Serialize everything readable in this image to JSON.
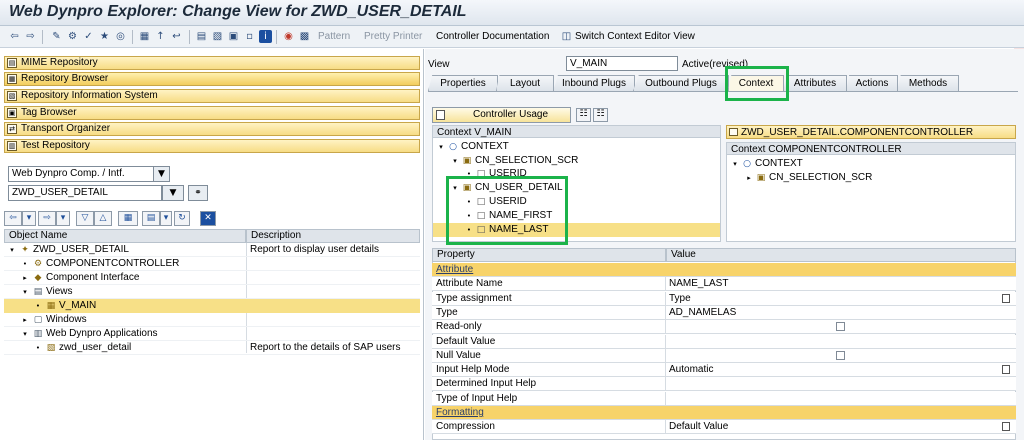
{
  "window": {
    "title": "Web Dynpro Explorer: Change View for ZWD_USER_DETAIL"
  },
  "toolbar": {
    "pattern_label": "Pattern",
    "pretty_printer_label": "Pretty Printer",
    "controller_documentation_label": "Controller Documentation",
    "switch_context_label": "Switch Context Editor View"
  },
  "left_nav": {
    "items": [
      {
        "label": "MIME Repository",
        "icon": "mime-icon"
      },
      {
        "label": "Repository Browser",
        "icon": "repository-icon"
      },
      {
        "label": "Repository Information System",
        "icon": "info-system-icon"
      },
      {
        "label": "Tag Browser",
        "icon": "tag-icon"
      },
      {
        "label": "Transport Organizer",
        "icon": "transport-icon"
      },
      {
        "label": "Test Repository",
        "icon": "test-icon"
      }
    ],
    "object_type": "Web Dynpro Comp. / Intf.",
    "object_name": "ZWD_USER_DETAIL"
  },
  "object_tree": {
    "col_name": "Object Name",
    "col_desc": "Description",
    "rows": [
      {
        "label": "ZWD_USER_DETAIL",
        "desc": "Report to display user details"
      },
      {
        "label": "COMPONENTCONTROLLER",
        "desc": ""
      },
      {
        "label": "Component Interface",
        "desc": ""
      },
      {
        "label": "Views",
        "desc": ""
      },
      {
        "label": "V_MAIN",
        "desc": ""
      },
      {
        "label": "Windows",
        "desc": ""
      },
      {
        "label": "Web Dynpro Applications",
        "desc": ""
      },
      {
        "label": "zwd_user_detail",
        "desc": "Report to the details of SAP users"
      }
    ]
  },
  "view_header": {
    "view_label": "View",
    "view_value": "V_MAIN",
    "status": "Active(revised)"
  },
  "tabs": [
    "Properties",
    "Layout",
    "Inbound Plugs",
    "Outbound Plugs",
    "Context",
    "Attributes",
    "Actions",
    "Methods"
  ],
  "context": {
    "controller_usage_label": "Controller Usage",
    "left_title": "Context V_MAIN",
    "right_header": "ZWD_USER_DETAIL.COMPONENTCONTROLLER",
    "right_title": "Context COMPONENTCONTROLLER",
    "left_nodes": [
      "CONTEXT",
      "CN_SELECTION_SCR",
      "USERID",
      "CN_USER_DETAIL",
      "USERID",
      "NAME_FIRST",
      "NAME_LAST"
    ],
    "right_nodes": [
      "CONTEXT",
      "CN_SELECTION_SCR"
    ]
  },
  "properties": {
    "col_property": "Property",
    "col_value": "Value",
    "rows": [
      {
        "property": "Attribute",
        "value": "",
        "type": "group"
      },
      {
        "property": "Attribute Name",
        "value": "NAME_LAST",
        "type": "text"
      },
      {
        "property": "Type assignment",
        "value": "Type",
        "type": "f4"
      },
      {
        "property": "Type",
        "value": "AD_NAMELAS",
        "type": "text"
      },
      {
        "property": "Read-only",
        "value": "",
        "type": "checkbox"
      },
      {
        "property": "Default Value",
        "value": "",
        "type": "text"
      },
      {
        "property": "Null Value",
        "value": "",
        "type": "checkbox"
      },
      {
        "property": "Input Help Mode",
        "value": "Automatic",
        "type": "f4"
      },
      {
        "property": "Determined Input Help",
        "value": "",
        "type": "text"
      },
      {
        "property": "Type of Input Help",
        "value": "",
        "type": "text"
      },
      {
        "property": "Formatting",
        "value": "",
        "type": "group"
      },
      {
        "property": "Compression",
        "value": "Default Value",
        "type": "f4"
      }
    ]
  },
  "colors": {
    "highlight": "#f7e087",
    "nav_button": "#f7dc85",
    "annotation_box": "#1bb34a",
    "window_border": "#d0343a"
  }
}
